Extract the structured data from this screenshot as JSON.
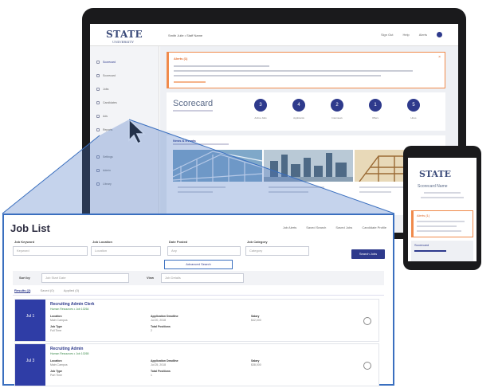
{
  "laptop": {
    "logo": "STATE",
    "logo_sub": "UNIVERSITY",
    "breadcrumb": "Smith Julie • Staff Name",
    "nav": [
      "Sign Out",
      "Help",
      "Alerts"
    ],
    "sidebar": [
      "Scorecard",
      "Scorecard",
      "Jobs",
      "Candidates",
      "Ads",
      "Reports",
      "Settings",
      "Admin",
      "Library"
    ],
    "alert_title": "Alerts (1)",
    "scorecard_title": "Scorecard",
    "metrics": [
      {
        "value": "3",
        "label": "Active Jobs"
      },
      {
        "value": "4",
        "label": "Applicants"
      },
      {
        "value": "2",
        "label": "Interviews"
      },
      {
        "value": "1",
        "label": "Offers"
      },
      {
        "value": "5",
        "label": "Hires"
      }
    ],
    "news_title": "News & Events"
  },
  "phone": {
    "logo": "STATE",
    "title": "Scorecard Name",
    "alert_title": "Alerts (1)",
    "score_title": "Scorecard"
  },
  "job_list": {
    "title": "Job List",
    "links": [
      "Job Alerts",
      "Saved Search",
      "Saved Jobs",
      "Candidate Profile"
    ],
    "filters": [
      {
        "label": "Job Keyword",
        "placeholder": "Keyword"
      },
      {
        "label": "Job Location",
        "placeholder": "Location"
      },
      {
        "label": "Date Posted",
        "placeholder": "Any"
      },
      {
        "label": "Job Category",
        "placeholder": "Category"
      }
    ],
    "search_label": "Search Jobs",
    "advanced_label": "Advanced Search",
    "sort_label": "Sort by",
    "sort_value": "Job Start Date",
    "view_label": "View",
    "view_value": "Job Details",
    "tabs": [
      "Results (2)",
      "Saved (0)",
      "Applied (0)"
    ],
    "jobs": [
      {
        "date": "Jul 1",
        "title": "Recruiting Admin Clerk",
        "subtitle": "Human Resources • Job 10264",
        "field1_label": "Location",
        "field1_value": "Main Campus",
        "field2_label": "Job Type",
        "field2_value": "Full Time",
        "field3_label": "Application Deadline",
        "field3_value": "Jul 20, 2018",
        "field4_label": "Total Positions",
        "field4_value": "2",
        "field5_label": "Salary",
        "field5_value": "$42,000"
      },
      {
        "date": "Jul 3",
        "title": "Recruiting Admin",
        "subtitle": "Human Resources • Job 10265",
        "field1_label": "Location",
        "field1_value": "Main Campus",
        "field2_label": "Job Type",
        "field2_value": "Part Time",
        "field3_label": "Application Deadline",
        "field3_value": "Jul 25, 2018",
        "field4_label": "Total Positions",
        "field4_value": "1",
        "field5_label": "Salary",
        "field5_value": "$38,000"
      }
    ]
  },
  "colors": {
    "brand": "#2e3a8c",
    "accent": "#f08a4b",
    "zoom_frame": "#3a6fbf"
  }
}
